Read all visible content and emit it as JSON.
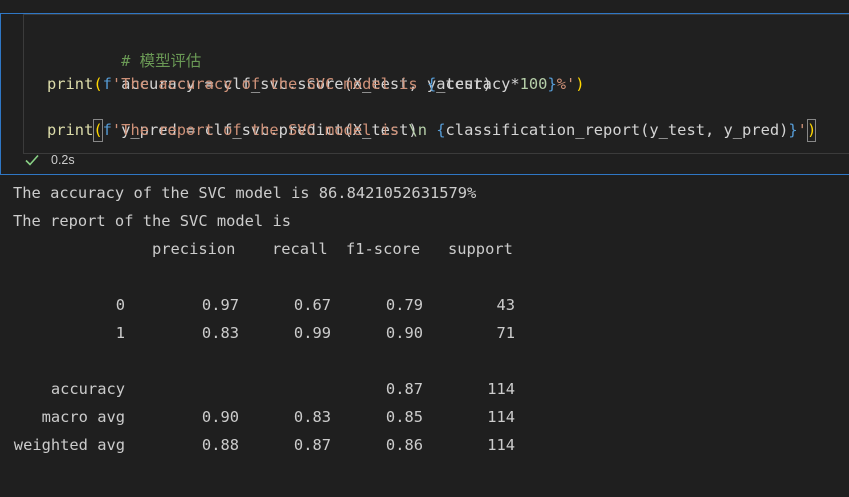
{
  "code_cell": {
    "lines": {
      "l1": "# 模型评估",
      "l2": "accuracy = clf_svc.score(X_test, y_test)",
      "l3_print": "print",
      "l3_open": "(",
      "l3_f": "f",
      "l3_str1": "'The accuracy of the SVC model is ",
      "l3_br_open": "{",
      "l3_expr": "accuracy*",
      "l3_num": "100",
      "l3_br_close": "}",
      "l3_str2": "%'",
      "l3_close": ")",
      "l4": "y_pred = clf_svc.predict(X_test)",
      "l5_print": "print",
      "l5_open": "(",
      "l5_f": "f",
      "l5_str1": "'The report of the SVC model is ",
      "l5_esc": "\\n",
      "l5_space": " ",
      "l5_br_open": "{",
      "l5_expr": "classification_report(y_test, y_pred)",
      "l5_br_close": "}",
      "l5_str2": "'",
      "l5_close": ")"
    },
    "status": {
      "icon": "check-icon",
      "time": "0.2s"
    }
  },
  "output": {
    "accuracy_line": "The accuracy of the SVC model is 86.8421052631579%",
    "report_title": "The report of the SVC model is ",
    "report": {
      "headers": {
        "precision": "precision",
        "recall": "recall",
        "f1": "f1-score",
        "support": "support"
      },
      "rows": [
        {
          "label": "0",
          "precision": "0.97",
          "recall": "0.67",
          "f1": "0.79",
          "support": "43"
        },
        {
          "label": "1",
          "precision": "0.83",
          "recall": "0.99",
          "f1": "0.90",
          "support": "71"
        }
      ],
      "accuracy": {
        "label": "accuracy",
        "f1": "0.87",
        "support": "114"
      },
      "macro": {
        "label": "macro avg",
        "precision": "0.90",
        "recall": "0.83",
        "f1": "0.85",
        "support": "114"
      },
      "weighted": {
        "label": "weighted avg",
        "precision": "0.88",
        "recall": "0.87",
        "f1": "0.86",
        "support": "114"
      }
    }
  },
  "colors": {
    "background": "#1f1f1f",
    "cell_border": "#2f77c5",
    "comment": "#6a9955",
    "function": "#dcdcaa",
    "string": "#ce9178",
    "number": "#b5cea8",
    "keyword": "#569cd6",
    "success": "#89d185"
  }
}
